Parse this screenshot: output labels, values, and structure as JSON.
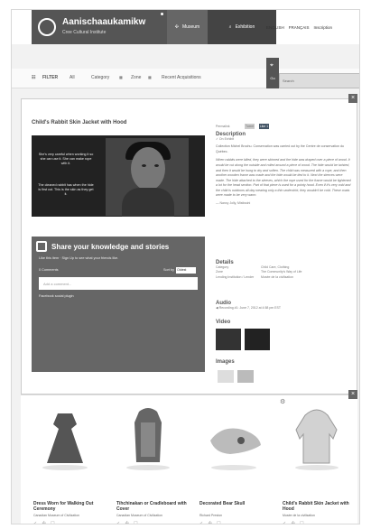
{
  "header": {
    "logo_title": "Aanischaaukamikw",
    "logo_subtitle": "Cree Cultural Institute",
    "tabs": [
      {
        "label": "Museum",
        "icon": "move-icon"
      },
      {
        "label": "Exhibition",
        "icon": "search-icon"
      }
    ],
    "links": [
      "ENGLISH",
      "FRANÇAIS",
      "Inscription"
    ]
  },
  "filters": {
    "label": "FILTER",
    "items": [
      "All",
      "Category",
      "Zone",
      "Recent Acquisitions"
    ],
    "search_button": "Go",
    "search_placeholder": "Search"
  },
  "item": {
    "title": "Child's Rabbit Skin Jacket with Hood",
    "video_captions": [
      "She's very careful when working it so she can use it. She can make rope with it.",
      "The cleaned rabbit has when the hide is first cut. This is the skin as they get it."
    ],
    "share_title": "Share your knowledge and stories",
    "share_subline": "Like this item · Sign Up to see what your friends like.",
    "comments": "0 Comments",
    "sort_label": "Sort by",
    "sort_value": "Oldest",
    "comment_placeholder": "Add a comment...",
    "facebook_plugin": "Facebook social plugin"
  },
  "details": {
    "permalink": "Permalink",
    "tweet": "Tweet",
    "like": "Like 1",
    "description_title": "Description",
    "on_exhibit": "On Exhibit",
    "collection_note": "Collection Michel Brochu. Conservation was carried out by the Centre de conservation du Québec.",
    "description_text": "When rabbits were killed, they were skinned and the hide was draped over a piece of wood. It would be cut along the outside and rolled around a piece of wood. The hide would be twisted, and then it would be hung to dry and soften. The child was measured with a rope, and then another wooden frame was made and the hide would be tied to it. Next the sleeves were made. The hide attached to the sleeves, which the rope used for the frame would be tightened a lot for the head section. Part of that piece is used for a pointy hood. Even if it's very cold and the child is outdoors all day wearing only a thin undershirt, they wouldn't be cold. These coats were made to be very warm.",
    "quote_author": "— Nancy Jolly, Mistissini",
    "details_title": "Details",
    "category_label": "Category",
    "category_value": "Child Care, Clothing",
    "zone_label": "Zone",
    "zone_value": "The Community's Way of Life",
    "lending_label": "Lending Institution / Lender",
    "lending_value": "Musée de la civilisation",
    "audio_title": "Audio",
    "audio_value": "Recording #1: June 7, 2012 at 4:58 pm EST",
    "video_title": "Video",
    "images_title": "Images"
  },
  "related": [
    {
      "title": "Dress Worn for Walking Out Ceremony",
      "museum": "Canadian Museum of Civilization"
    },
    {
      "title": "Tihchinakan or Cradleboard with Cover",
      "museum": "Canadian Museum of Civilization"
    },
    {
      "title": "Decorated Bear Skull",
      "museum": "Richard Preston"
    },
    {
      "title": "Child's Rabbit Skin Jacket with Hood",
      "museum": "Musée de la civilisation"
    }
  ],
  "symbols": {
    "close": "×",
    "check": "✓",
    "gear": "⚙"
  }
}
